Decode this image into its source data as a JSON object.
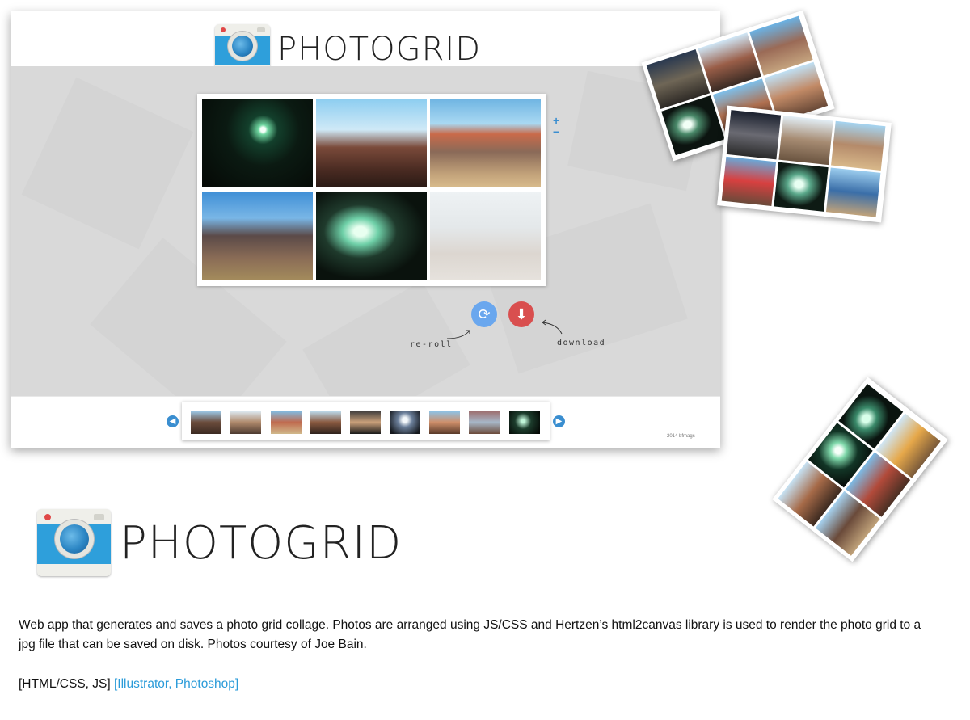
{
  "app": {
    "logo_text": "PHOTOGRID",
    "zoom_in_label": "+",
    "zoom_out_label": "−",
    "reroll_icon": "refresh-icon",
    "download_icon": "cloud-download-icon",
    "reroll_label": "re-roll",
    "download_label": "download",
    "prev_icon": "arrow-left-icon",
    "next_icon": "arrow-right-icon",
    "copyright": "2014 bfmags",
    "colors": {
      "accent": "#3a8ed0",
      "reroll": "#6aa7ee",
      "download": "#d94f4f",
      "main_bg": "#d9d9d9"
    }
  },
  "grid_photos": [
    {
      "name": "night-stage-light"
    },
    {
      "name": "festival-crowd-tower"
    },
    {
      "name": "festival-flags-walkway"
    },
    {
      "name": "crowd-sitting-grass"
    },
    {
      "name": "lit-food-stall-night"
    },
    {
      "name": "faded-empty-slot"
    }
  ],
  "thumbnails": [
    "thumb-1",
    "thumb-2",
    "thumb-3",
    "thumb-4",
    "thumb-5",
    "thumb-6",
    "thumb-7",
    "thumb-8",
    "thumb-9"
  ],
  "brand": {
    "logo_text": "PHOTOGRID"
  },
  "description": {
    "text": "Web app that generates and saves a photo grid collage. Photos are arranged using JS/CSS and  Hertzen’s html2canvas library is used to render the photo grid to a jpg file that can be saved on disk. Photos courtesy of Joe Bain.",
    "tech": "[HTML/CSS, JS]",
    "tools": "[Illustrator, Photoshop]"
  }
}
